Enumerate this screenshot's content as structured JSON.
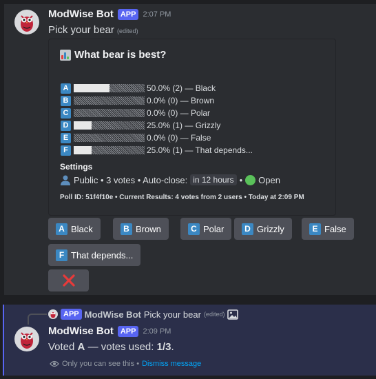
{
  "message1": {
    "author": "ModWise Bot",
    "badge": "APP",
    "time": "2:07 PM",
    "content": "Pick your bear",
    "edited": "(edited)"
  },
  "poll": {
    "title": "What bear is best?",
    "options": [
      {
        "letter": "A",
        "label": "50.0% (2) — Black",
        "percent": 50
      },
      {
        "letter": "B",
        "label": "0.0% (0) — Brown",
        "percent": 0
      },
      {
        "letter": "C",
        "label": "0.0% (0) — Polar",
        "percent": 0
      },
      {
        "letter": "D",
        "label": "25.0% (1) — Grizzly",
        "percent": 25
      },
      {
        "letter": "E",
        "label": "0.0% (0) — False",
        "percent": 0
      },
      {
        "letter": "F",
        "label": "25.0% (1) — That depends...",
        "percent": 25
      }
    ],
    "settings_heading": "Settings",
    "settings_prefix": "Public • 3 votes • Auto-close:",
    "auto_close": "in 12 hours",
    "status": "Open",
    "footer": "Poll ID: 51f4f10e • Current Results: 4 votes from 2 users • Today at 2:09 PM"
  },
  "buttons": [
    {
      "letter": "A",
      "label": "Black"
    },
    {
      "letter": "B",
      "label": "Brown"
    },
    {
      "letter": "C",
      "label": "Polar"
    },
    {
      "letter": "D",
      "label": "Grizzly"
    },
    {
      "letter": "E",
      "label": "False"
    },
    {
      "letter": "F",
      "label": "That depends..."
    }
  ],
  "message2": {
    "reply_badge": "APP",
    "reply_author": "ModWise Bot",
    "reply_text": "Pick your bear",
    "reply_edited": "(edited)",
    "author": "ModWise Bot",
    "badge": "APP",
    "time": "2:09 PM",
    "voted_prefix": "Voted",
    "voted_letter": "A",
    "voted_mid": "— votes used:",
    "voted_count": "1/3",
    "voted_end": ".",
    "ephemeral_text": "Only you can see this •",
    "dismiss": "Dismiss message"
  },
  "colors": {
    "accent": "#5865f2",
    "letter_bg": "#3b88c3",
    "danger": "#e83a3a",
    "link": "#00a8fc"
  }
}
